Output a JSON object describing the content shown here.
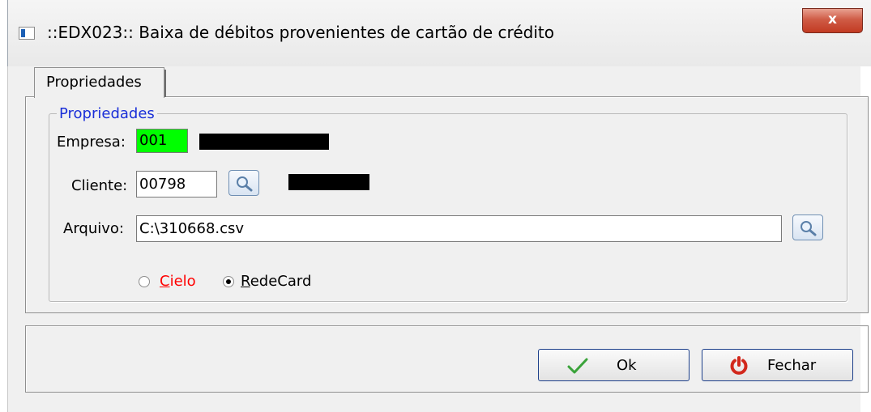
{
  "window": {
    "title": "::EDX023:: Baixa de débitos provenientes de cartão de crédito",
    "close_label": "x"
  },
  "tabs": [
    {
      "label": "Propriedades",
      "selected": true
    }
  ],
  "group": {
    "title": "Propriedades",
    "title_color": "#1a2fd8",
    "empresa": {
      "label": "Empresa:",
      "value": "001",
      "highlight_color": "#00ff00"
    },
    "cliente": {
      "label": "Cliente:",
      "value": "00798"
    },
    "arquivo": {
      "label": "Arquivo:",
      "value": "C:\\310668.csv"
    },
    "radio_options": [
      {
        "label": "Cielo",
        "selected": false,
        "color": "#ff0000"
      },
      {
        "label": "RedeCard",
        "selected": true,
        "color": "#000000"
      }
    ]
  },
  "buttons": {
    "ok": {
      "label": "Ok",
      "icon": "checkmark-icon"
    },
    "fechar": {
      "label": "Fechar",
      "icon": "power-icon"
    }
  },
  "colors": {
    "close_button": "#c23a22",
    "button_border": "#1c3f8a"
  }
}
